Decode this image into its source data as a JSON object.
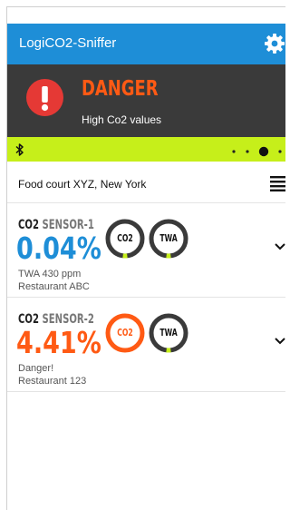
{
  "app": {
    "title": "LogiCO2-Sniffer",
    "settings_icon": "gear-icon"
  },
  "alert": {
    "level": "DANGER",
    "message": "High Co2 values",
    "icon": "exclamation-icon"
  },
  "status": {
    "bluetooth_icon": "bluetooth-icon",
    "page_indicator_icon": "page-dots-icon"
  },
  "location": {
    "text": "Food court XYZ, New York",
    "menu_icon": "hamburger-menu-icon"
  },
  "colors": {
    "appbar": "#1e8ed7",
    "danger": "#ff5a14",
    "ok": "#1e8ed7",
    "status": "#c6ef1a",
    "alert_bg": "#3a3a3a"
  },
  "sensors": [
    {
      "name_prefix": "CO2",
      "name_rest": "SENSOR-1",
      "value": "0.04%",
      "detail": "TWA 430 ppm",
      "location": "Restaurant ABC",
      "state": "ok",
      "gauges": [
        {
          "label": "CO2",
          "level": 0.04
        },
        {
          "label": "TWA",
          "level": 0.04
        }
      ]
    },
    {
      "name_prefix": "CO2",
      "name_rest": "SENSOR-2",
      "value": "4.41%",
      "detail": "Danger!",
      "location": "Restaurant 123",
      "state": "danger",
      "gauges": [
        {
          "label": "CO2",
          "level": 1.0
        },
        {
          "label": "TWA",
          "level": 0.04
        }
      ]
    }
  ]
}
